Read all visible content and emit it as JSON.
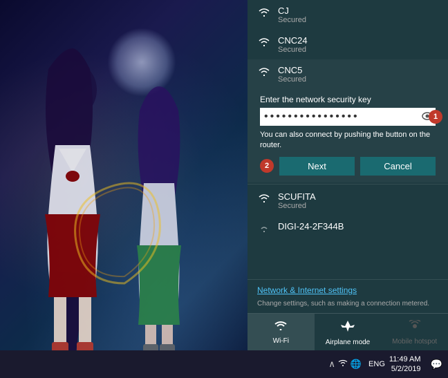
{
  "wallpaper": {
    "alt": "Anime character wallpaper"
  },
  "wifi_panel": {
    "networks": [
      {
        "id": "cj",
        "name": "CJ",
        "status": "Secured",
        "expanded": false
      },
      {
        "id": "cnc24",
        "name": "CNC24",
        "status": "Secured",
        "expanded": false
      },
      {
        "id": "cnc5",
        "name": "CNC5",
        "status": "Secured",
        "expanded": true
      },
      {
        "id": "scufita",
        "name": "SCUFITA",
        "status": "Secured",
        "expanded": false
      },
      {
        "id": "digi",
        "name": "DIGI-24-2F344B",
        "status": "",
        "expanded": false
      }
    ],
    "expanded_network": {
      "label": "Enter the network security key",
      "password_placeholder": "••••••••••••••••",
      "hint": "You can also connect by pushing the button on the router.",
      "badge1": "1",
      "badge2": "2",
      "next_label": "Next",
      "cancel_label": "Cancel"
    },
    "network_settings": {
      "link": "Network & Internet settings",
      "description": "Change settings, such as making a connection metered."
    },
    "tabs": [
      {
        "id": "wifi",
        "label": "Wi-Fi",
        "icon": "wifi",
        "active": true,
        "disabled": false
      },
      {
        "id": "airplane",
        "label": "Airplane mode",
        "icon": "airplane",
        "active": false,
        "disabled": false
      },
      {
        "id": "hotspot",
        "label": "Mobile hotspot",
        "icon": "hotspot",
        "active": false,
        "disabled": true
      }
    ]
  },
  "taskbar": {
    "time": "11:49 AM",
    "date": "5/2/2019",
    "lang": "ENG"
  }
}
